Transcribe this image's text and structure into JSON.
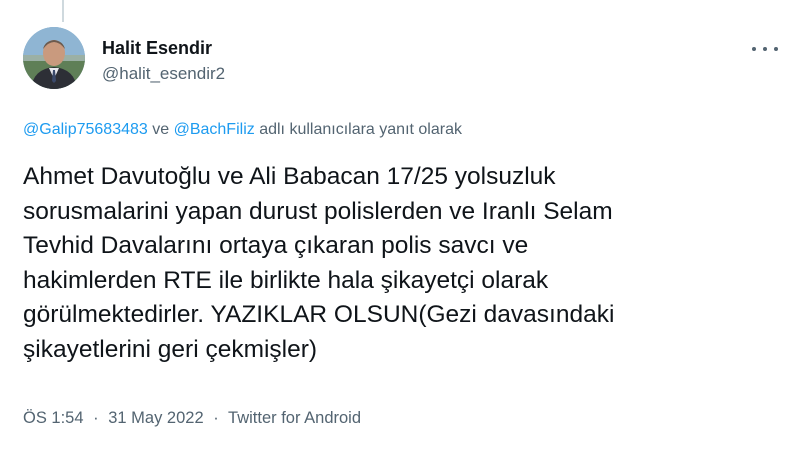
{
  "author": {
    "display_name": "Halit Esendir",
    "handle": "@halit_esendir2",
    "avatar_icon": "profile-photo"
  },
  "reply_context": {
    "user1": "@Galip75683483",
    "joiner": "ve",
    "user2": "@BachFiliz",
    "suffix": "adlı kullanıcılara yanıt olarak"
  },
  "tweet_lines": [
    "Ahmet Davutoğlu ve Ali Babacan 17/25 yolsuzluk",
    "sorusmalarini yapan durust polislerden ve Iranlı Selam",
    "Tevhid Davalarını ortaya çıkaran polis savcı ve",
    "hakimlerden RTE ile birlikte hala şikayetçi olarak",
    "görülmektedirler. YAZIKLAR OLSUN(Gezi davasındaki",
    "şikayetlerini geri çekmişler)"
  ],
  "meta": {
    "time": "ÖS 1:54",
    "date": "31 May 2022",
    "source": "Twitter for Android",
    "separator": "·"
  },
  "colors": {
    "link": "#1d9bf0",
    "secondary_text": "#536471",
    "primary_text": "#0f1419"
  },
  "icons": {
    "more": "more-horizontal-icon"
  }
}
